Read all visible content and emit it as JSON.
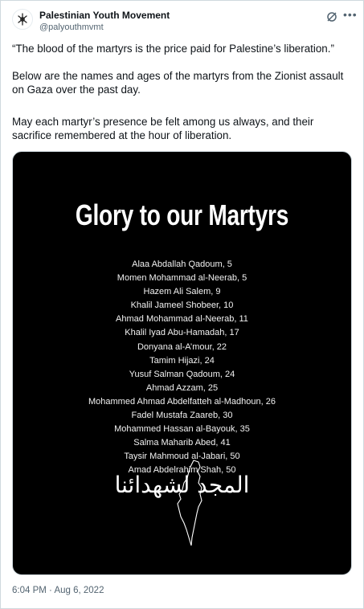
{
  "tweet": {
    "author_name": "Palestinian Youth Movement",
    "author_handle": "@palyouthmvmt",
    "paragraph_1": "“The blood of the martyrs is the price paid for Palestine’s liberation.”",
    "paragraph_2": "Below are the names and ages of the martyrs from the Zionist assault on Gaza over the past day.",
    "paragraph_3": "May each martyr’s presence be felt among us always, and their sacrifice remembered at the hour of liberation.",
    "time": "6:04 PM",
    "separator": "·",
    "date": "Aug 6, 2022",
    "icons": {
      "grok": "grok-icon",
      "more": "more-options-icon",
      "avatar_logo": "pym-logo"
    }
  },
  "media": {
    "title": "Glory to our Martyrs",
    "names": [
      "Alaa Abdallah Qadoum, 5",
      "Momen Mohammad al-Neerab, 5",
      "Hazem Ali Salem, 9",
      "Khalil Jameel Shobeer, 10",
      "Ahmad Mohammad al-Neerab, 11",
      "Khalil Iyad Abu-Hamadah, 17",
      "Donyana al-A’mour, 22",
      "Tamim Hijazi, 24",
      "Yusuf Salman Qadoum, 24",
      "Ahmad Azzam, 25",
      "Mohammed Ahmad Abdelfatteh al-Madhoun, 26",
      "Fadel Mustafa Zaareb, 30",
      "Mohammed Hassan al-Bayouk, 35",
      "Salma Maharib Abed, 41",
      "Taysir Mahmoud al-Jabari, 50",
      "Amad Abdelrahim Shah, 50"
    ],
    "arabic_text": "المجد لشهدائنا",
    "background": "#000000",
    "text_color": "#ffffff"
  },
  "colors": {
    "text": "#0f1419",
    "muted": "#536471",
    "border": "#cfd9de"
  }
}
